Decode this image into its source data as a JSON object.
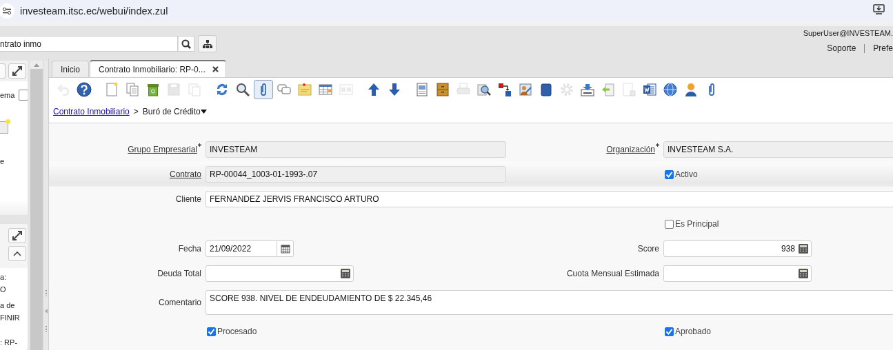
{
  "browser": {
    "url": "investeam.itsc.ec/webui/index.zul"
  },
  "header": {
    "search_value": "ntrato inmo",
    "user": "SuperUser@INVESTEAM.",
    "links": [
      "Soporte",
      "Prefe"
    ]
  },
  "west_panel": {
    "top_texts": [
      "ema",
      "e"
    ],
    "checkbox": {
      "checked": false
    },
    "bottom_texts": [
      "a:",
      "O",
      "a de",
      "FINIR",
      ": RP-"
    ]
  },
  "tabs": [
    {
      "label": "Inicio",
      "selected": false,
      "closable": false
    },
    {
      "label": "Contrato Inmobiliario: RP-0...",
      "selected": true,
      "closable": true
    }
  ],
  "toolbar": [
    {
      "disabled": true,
      "pressed": false
    },
    {
      "disabled": false,
      "pressed": false
    },
    {
      "disabled": false,
      "pressed": false
    },
    {
      "disabled": false,
      "pressed": false
    },
    {
      "disabled": false,
      "pressed": false
    },
    {
      "disabled": true,
      "pressed": false
    },
    {
      "disabled": true,
      "pressed": false
    },
    {
      "disabled": false,
      "pressed": false
    },
    {
      "disabled": false,
      "pressed": false
    },
    {
      "disabled": false,
      "pressed": true
    },
    {
      "disabled": false,
      "pressed": false
    },
    {
      "disabled": false,
      "pressed": false
    },
    {
      "disabled": false,
      "pressed": false
    },
    {
      "disabled": true,
      "pressed": false
    },
    {
      "disabled": false,
      "pressed": false
    },
    {
      "disabled": false,
      "pressed": false
    },
    {
      "disabled": false,
      "pressed": false
    },
    {
      "disabled": false,
      "pressed": false
    },
    {
      "disabled": true,
      "pressed": false
    },
    {
      "disabled": false,
      "pressed": false
    },
    {
      "disabled": false,
      "pressed": false
    },
    {
      "disabled": false,
      "pressed": false
    },
    {
      "disabled": false,
      "pressed": false
    },
    {
      "disabled": true,
      "pressed": false
    },
    {
      "disabled": false,
      "pressed": false
    },
    {
      "disabled": false,
      "pressed": false
    },
    {
      "disabled": true,
      "pressed": false
    },
    {
      "disabled": false,
      "pressed": false
    },
    {
      "disabled": false,
      "pressed": false
    },
    {
      "disabled": false,
      "pressed": false
    },
    {
      "disabled": false,
      "pressed": false
    }
  ],
  "breadcrumb": {
    "parent": "Contrato Inmobiliario",
    "separator": ">",
    "current": "Buró de Crédito"
  },
  "form": {
    "rows": [
      {
        "highlighted": false,
        "left": {
          "kind": "text",
          "label": "Grupo Empresarial",
          "value": "INVESTEAM",
          "readonly": true,
          "mandatory": true,
          "link": true
        },
        "right": {
          "kind": "text",
          "label": "Organización",
          "value": "INVESTEAM S.A.",
          "readonly": true,
          "mandatory": true,
          "link": true
        }
      },
      {
        "highlighted": true,
        "left": {
          "kind": "text",
          "label": "Contrato",
          "value": "RP-00044_1003-01-1993-.07",
          "readonly": true,
          "mandatory": false,
          "link": true
        },
        "right": {
          "kind": "checkbox",
          "label": "Activo",
          "checked": true
        }
      },
      {
        "highlighted": false,
        "span": {
          "kind": "text",
          "label": "Cliente",
          "value": "FERNANDEZ JERVIS FRANCISCO ARTURO",
          "readonly": false,
          "mandatory": false,
          "link": false
        }
      },
      {
        "highlighted": false,
        "right": {
          "kind": "checkbox",
          "label": "Es Principal",
          "checked": false
        }
      },
      {
        "highlighted": false,
        "left": {
          "kind": "date",
          "label": "Fecha",
          "value": "21/09/2022",
          "mandatory": false,
          "link": false
        },
        "right": {
          "kind": "number",
          "label": "Score",
          "value": "938",
          "mandatory": false,
          "link": false
        }
      },
      {
        "highlighted": false,
        "left": {
          "kind": "number",
          "label": "Deuda Total",
          "mandatory": false,
          "link": false
        },
        "right": {
          "kind": "number",
          "label": "Cuota Mensual Estimada",
          "mandatory": false,
          "link": false
        }
      },
      {
        "highlighted": false,
        "span": {
          "kind": "textarea",
          "label": "Comentario",
          "value": "SCORE 938. NIVEL DE ENDEUDAMIENTO DE $ 22.345,46",
          "mandatory": false,
          "link": false
        }
      },
      {
        "highlighted": false,
        "left": {
          "kind": "checkbox",
          "label": "Procesado",
          "checked": true
        },
        "right": {
          "kind": "checkbox",
          "label": "Aprobado",
          "checked": true
        }
      }
    ]
  }
}
